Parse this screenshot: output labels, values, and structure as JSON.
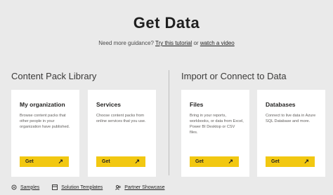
{
  "header": {
    "title": "Get Data",
    "guidance_prefix": "Need more guidance?",
    "tutorial_link": "Try this tutorial",
    "or_text": "or",
    "video_link": "watch a video"
  },
  "sections": {
    "left_title": "Content Pack Library",
    "right_title": "Import or Connect to Data"
  },
  "cards": [
    {
      "title": "My organization",
      "description": "Browse content packs that other people in your organization have published.",
      "button": "Get"
    },
    {
      "title": "Services",
      "description": "Choose content packs from online services that you use.",
      "button": "Get"
    },
    {
      "title": "Files",
      "description": "Bring in your reports, workbooks, or data from Excel, Power BI Desktop or CSV files.",
      "button": "Get"
    },
    {
      "title": "Databases",
      "description": "Connect to live data in Azure SQL Database and more.",
      "button": "Get"
    }
  ],
  "footer": {
    "samples": "Samples",
    "solution_templates": "Solution Templates",
    "partner_showcase": "Partner Showcase"
  },
  "colors": {
    "accent": "#f2c811",
    "background": "#eaeaea"
  },
  "icons": [
    "arrow-up-right-icon",
    "samples-icon",
    "templates-icon",
    "partner-icon"
  ]
}
